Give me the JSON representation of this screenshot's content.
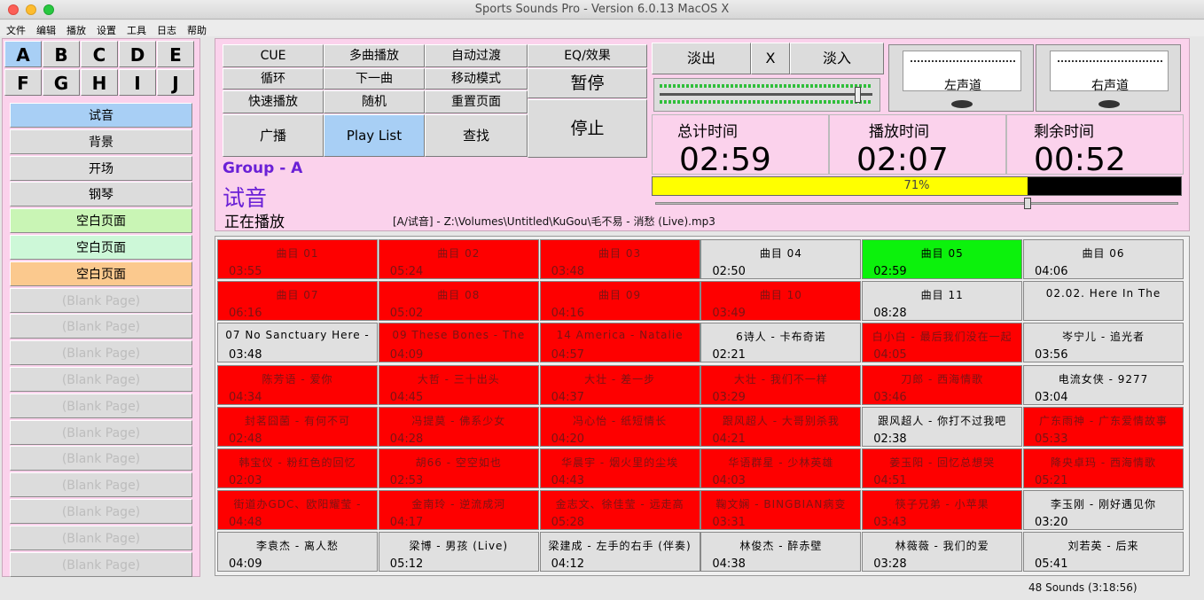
{
  "window": {
    "title": "Sports Sounds Pro - Version 6.0.13    MacOS X"
  },
  "menu": [
    "文件",
    "编辑",
    "播放",
    "设置",
    "工具",
    "日志",
    "帮助"
  ],
  "groups": [
    "A",
    "B",
    "C",
    "D",
    "E",
    "F",
    "G",
    "H",
    "I",
    "J"
  ],
  "pages": [
    {
      "label": "试音",
      "color": "#a8cff5"
    },
    {
      "label": "背景",
      "color": "#dcdcdc"
    },
    {
      "label": "开场",
      "color": "#dcdcdc"
    },
    {
      "label": "钢琴",
      "color": "#dcdcdc"
    },
    {
      "label": "空白页面",
      "color": "#c9f5b5"
    },
    {
      "label": "空白页面",
      "color": "#cdf8d8"
    },
    {
      "label": "空白页面",
      "color": "#fbc98e"
    },
    {
      "label": "(Blank Page)",
      "color": "#dcdcdc"
    },
    {
      "label": "(Blank Page)",
      "color": "#dcdcdc"
    },
    {
      "label": "(Blank Page)",
      "color": "#dcdcdc"
    },
    {
      "label": "(Blank Page)",
      "color": "#dcdcdc"
    },
    {
      "label": "(Blank Page)",
      "color": "#dcdcdc"
    },
    {
      "label": "(Blank Page)",
      "color": "#dcdcdc"
    },
    {
      "label": "(Blank Page)",
      "color": "#dcdcdc"
    },
    {
      "label": "(Blank Page)",
      "color": "#dcdcdc"
    },
    {
      "label": "(Blank Page)",
      "color": "#dcdcdc"
    },
    {
      "label": "(Blank Page)",
      "color": "#dcdcdc"
    },
    {
      "label": "(Blank Page)",
      "color": "#dcdcdc"
    }
  ],
  "controls": {
    "cue": "CUE",
    "multi": "多曲播放",
    "autofade": "自动过渡",
    "eq": "EQ/效果",
    "loop": "循环",
    "next": "下一曲",
    "move": "移动模式",
    "pause": "暂停",
    "fast": "快速播放",
    "random": "随机",
    "overlay": "重置页面",
    "stop": "停止",
    "broadcast": "广播",
    "playlist": "Play List",
    "find": "查找"
  },
  "fade": {
    "out": "淡出",
    "x": "X",
    "in": "淡入"
  },
  "meters": {
    "left": "左声道",
    "right": "右声道"
  },
  "times": {
    "total_label": "总计时间",
    "total": "02:59",
    "play_label": "播放时间",
    "play": "02:07",
    "remain_label": "剩余时间",
    "remain": "00:52"
  },
  "progress": {
    "label": "71%",
    "value": 0.71
  },
  "status": {
    "group": "Group - A",
    "page": "试音",
    "now": "正在播放",
    "path": "[A/试音] - Z:\\Volumes\\Untitled\\KuGou\\毛不易 - 消愁 (Live).mp3"
  },
  "footer": "48 Sounds (3:18:56)",
  "sounds": [
    {
      "n": "曲目 01",
      "d": "03:55",
      "c": "red"
    },
    {
      "n": "曲目 02",
      "d": "05:24",
      "c": "red"
    },
    {
      "n": "曲目 03",
      "d": "03:48",
      "c": "red"
    },
    {
      "n": "曲目 04",
      "d": "02:50",
      "c": "gray"
    },
    {
      "n": "曲目 05",
      "d": "02:59",
      "c": "green"
    },
    {
      "n": "曲目 06",
      "d": "04:06",
      "c": "gray"
    },
    {
      "n": "曲目 07",
      "d": "06:16",
      "c": "red"
    },
    {
      "n": "曲目 08",
      "d": "05:02",
      "c": "red"
    },
    {
      "n": "曲目 09",
      "d": "04:16",
      "c": "red"
    },
    {
      "n": "曲目 10",
      "d": "03:49",
      "c": "red"
    },
    {
      "n": "曲目 11",
      "d": "08:28",
      "c": "gray"
    },
    {
      "n": "02.02. Here In The",
      "d": "",
      "c": "gray"
    },
    {
      "n": "07 No Sanctuary Here -",
      "d": "03:48",
      "c": "gray"
    },
    {
      "n": "09 These Bones - The",
      "d": "04:09",
      "c": "red"
    },
    {
      "n": "14 America - Natalie",
      "d": "04:57",
      "c": "red"
    },
    {
      "n": "6诗人 - 卡布奇诺",
      "d": "02:21",
      "c": "gray"
    },
    {
      "n": "白小白 - 最后我们没在一起",
      "d": "04:05",
      "c": "red"
    },
    {
      "n": "岑宁儿 - 追光者",
      "d": "03:56",
      "c": "gray"
    },
    {
      "n": "陈芳语 - 爱你",
      "d": "04:34",
      "c": "red"
    },
    {
      "n": "大哲 - 三十出头",
      "d": "04:45",
      "c": "red"
    },
    {
      "n": "大壮 - 差一步",
      "d": "04:37",
      "c": "red"
    },
    {
      "n": "大壮 - 我们不一样",
      "d": "03:29",
      "c": "red"
    },
    {
      "n": "刀郎 - 西海情歌",
      "d": "03:46",
      "c": "red"
    },
    {
      "n": "电流女侠 - 9277",
      "d": "03:04",
      "c": "gray"
    },
    {
      "n": "封茗囧菌 - 有何不可",
      "d": "02:48",
      "c": "red"
    },
    {
      "n": "冯提莫 - 佛系少女",
      "d": "04:28",
      "c": "red"
    },
    {
      "n": "冯心怡 - 纸短情长",
      "d": "04:20",
      "c": "red"
    },
    {
      "n": "跟风超人 - 大哥别杀我",
      "d": "04:21",
      "c": "red"
    },
    {
      "n": "跟风超人 - 你打不过我吧",
      "d": "02:38",
      "c": "gray"
    },
    {
      "n": "广东雨神 - 广东爱情故事",
      "d": "05:33",
      "c": "red"
    },
    {
      "n": "韩宝仪 - 粉红色的回忆",
      "d": "02:03",
      "c": "red"
    },
    {
      "n": "胡66 - 空空如也",
      "d": "02:53",
      "c": "red"
    },
    {
      "n": "华晨宇 - 烟火里的尘埃",
      "d": "04:43",
      "c": "red"
    },
    {
      "n": "华语群星 - 少林英雄",
      "d": "04:03",
      "c": "red"
    },
    {
      "n": "姜玉阳 - 回忆总想哭",
      "d": "04:51",
      "c": "red"
    },
    {
      "n": "降央卓玛 - 西海情歌",
      "d": "05:21",
      "c": "red"
    },
    {
      "n": "街道办GDC、欧阳耀莹 -",
      "d": "04:48",
      "c": "red"
    },
    {
      "n": "金南玲 - 逆流成河",
      "d": "04:17",
      "c": "red"
    },
    {
      "n": "金志文、徐佳莹 - 远走高",
      "d": "05:28",
      "c": "red"
    },
    {
      "n": "鞠文娴 - BINGBIAN病变",
      "d": "03:31",
      "c": "red"
    },
    {
      "n": "筷子兄弟 - 小苹果",
      "d": "03:43",
      "c": "red"
    },
    {
      "n": "李玉刚 - 刚好遇见你",
      "d": "03:20",
      "c": "gray"
    },
    {
      "n": "李袁杰 - 离人愁",
      "d": "04:09",
      "c": "gray"
    },
    {
      "n": "梁博 - 男孩 (Live)",
      "d": "05:12",
      "c": "gray"
    },
    {
      "n": "梁建成 - 左手的右手 (伴奏)",
      "d": "04:12",
      "c": "gray"
    },
    {
      "n": "林俊杰 - 醉赤壁",
      "d": "04:38",
      "c": "gray"
    },
    {
      "n": "林薇薇 - 我们的爱",
      "d": "03:28",
      "c": "gray"
    },
    {
      "n": "刘若英 - 后来",
      "d": "05:41",
      "c": "gray"
    }
  ]
}
